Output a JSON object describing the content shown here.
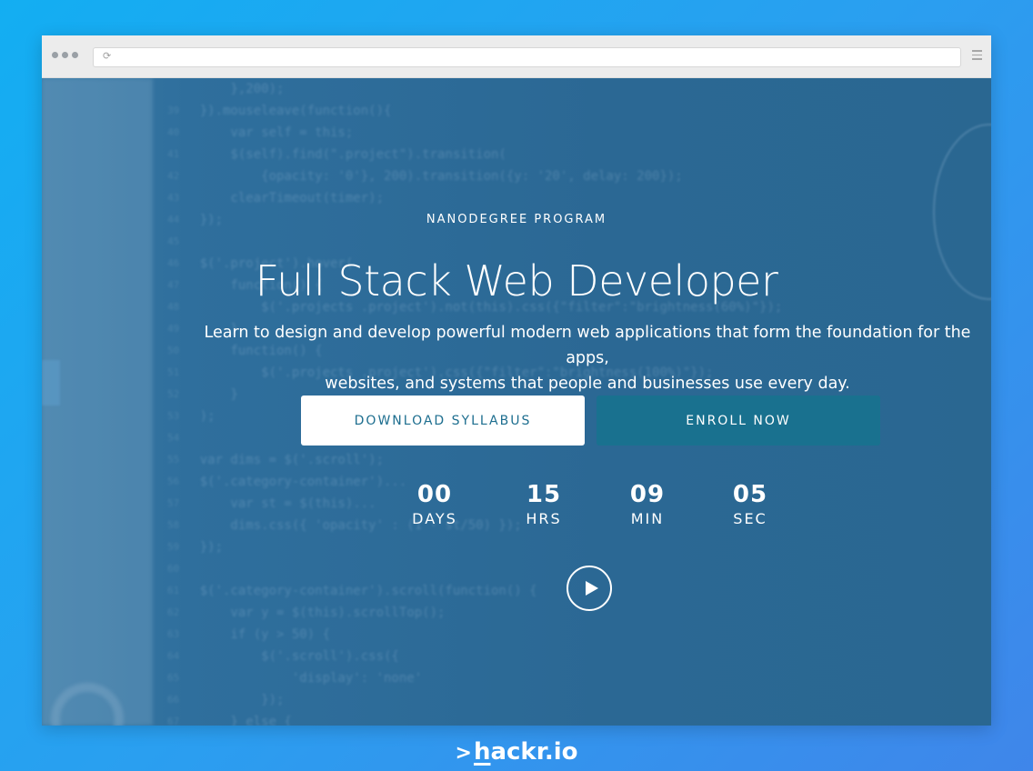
{
  "hero": {
    "eyebrow": "NANODEGREE PROGRAM",
    "title": "Full Stack Web Developer",
    "description_line1": "Learn to design and develop powerful modern web applications that form the foundation for the apps,",
    "description_line2": "websites, and systems that people and businesses use every day.",
    "download_label": "DOWNLOAD SYLLABUS",
    "enroll_label": "ENROLL NOW"
  },
  "countdown": [
    {
      "value": "00",
      "unit": "DAYS"
    },
    {
      "value": "15",
      "unit": "HRS"
    },
    {
      "value": "09",
      "unit": "MIN"
    },
    {
      "value": "05",
      "unit": "SEC"
    }
  ],
  "brand": {
    "caret": ">",
    "first_letter": "h",
    "rest": "ackr.io"
  },
  "icons": {
    "reload": "reload-icon",
    "menu": "hamburger-menu-icon",
    "play": "play-icon"
  },
  "colors": {
    "background_from": "#13aef2",
    "background_to": "#3f86ea",
    "hero_overlay": "#2b6894",
    "enroll_button": "#19718f",
    "download_text": "#1d6e8f"
  }
}
